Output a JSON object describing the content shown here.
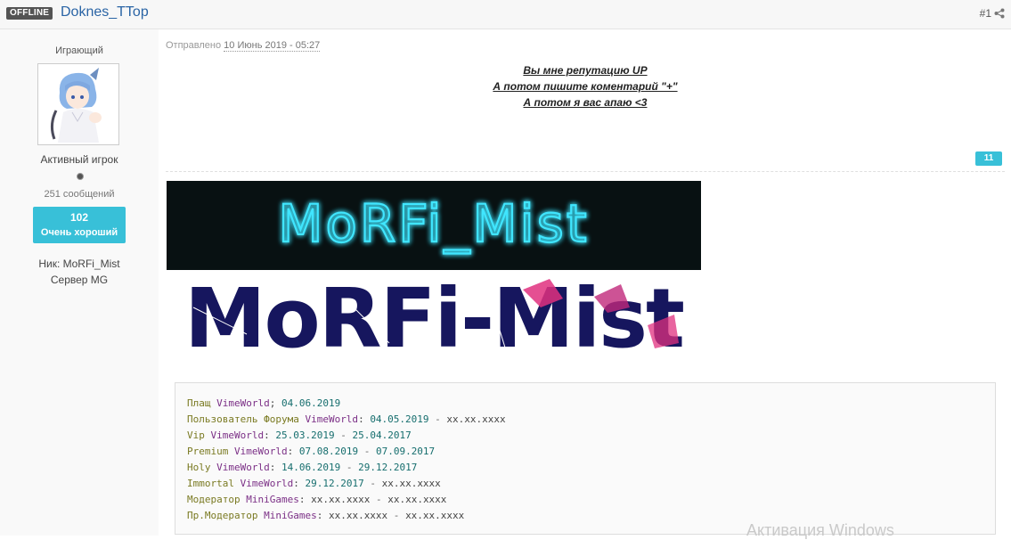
{
  "header": {
    "status_badge": "OFFLINE",
    "author_name": "Doknes_TTop",
    "post_number": "#1",
    "share_icon": "share-icon"
  },
  "sidebar": {
    "group_title": "Играющий",
    "rank_title": "Активный игрок",
    "post_count": "251 сообщений",
    "reputation_value": "102",
    "reputation_label": "Очень хороший",
    "custom_fields": [
      "Ник: MoRFi_Mist",
      "Сервер MG"
    ]
  },
  "post": {
    "meta_prefix": "Отправлено",
    "date": "10 Июнь 2019 - 05:27",
    "lines": [
      "Вы мне репутацию UP",
      "А потом пишите коментарий \"+\"",
      "А потом я вас апаю <3"
    ],
    "like_count": "11"
  },
  "signature": {
    "banner1_text": "MoRFi_Mist",
    "banner2_text": "MoRFi-Mist",
    "colors": {
      "neon": "#3fe6ff",
      "navy": "#16165e",
      "pink": "#e0307f"
    }
  },
  "code_lines": [
    [
      {
        "t": "Плащ ",
        "c": "name"
      },
      {
        "t": "VimeWorld",
        "c": "kw"
      },
      {
        "t": "; ",
        "c": "plain"
      },
      {
        "t": "04.06.2019",
        "c": "date"
      }
    ],
    [
      {
        "t": "Пользователь Форума ",
        "c": "name"
      },
      {
        "t": "VimeWorld",
        "c": "kw"
      },
      {
        "t": ": ",
        "c": "plain"
      },
      {
        "t": "04.05.2019",
        "c": "date"
      },
      {
        "t": " - ",
        "c": "dash"
      },
      {
        "t": "xx.xx.xxxx",
        "c": "plain"
      }
    ],
    [
      {
        "t": "Vip ",
        "c": "name"
      },
      {
        "t": "VimeWorld",
        "c": "kw"
      },
      {
        "t": ": ",
        "c": "plain"
      },
      {
        "t": "25.03.2019",
        "c": "date"
      },
      {
        "t": " - ",
        "c": "dash"
      },
      {
        "t": "25.04.2017",
        "c": "date"
      }
    ],
    [
      {
        "t": "Premium ",
        "c": "name"
      },
      {
        "t": "VimeWorld",
        "c": "kw"
      },
      {
        "t": ": ",
        "c": "plain"
      },
      {
        "t": "07.08.2019",
        "c": "date"
      },
      {
        "t": " - ",
        "c": "dash"
      },
      {
        "t": "07.09.2017",
        "c": "date"
      }
    ],
    [
      {
        "t": "Holy ",
        "c": "name"
      },
      {
        "t": "VimeWorld",
        "c": "kw"
      },
      {
        "t": ": ",
        "c": "plain"
      },
      {
        "t": "14.06.2019",
        "c": "date"
      },
      {
        "t": " - ",
        "c": "dash"
      },
      {
        "t": "29.12.2017",
        "c": "date"
      }
    ],
    [
      {
        "t": "Immortal ",
        "c": "name"
      },
      {
        "t": "VimeWorld",
        "c": "kw"
      },
      {
        "t": ": ",
        "c": "plain"
      },
      {
        "t": "29.12.2017",
        "c": "date"
      },
      {
        "t": " - ",
        "c": "dash"
      },
      {
        "t": "xx.xx.xxxx",
        "c": "plain"
      }
    ],
    [
      {
        "t": "Модератор ",
        "c": "name"
      },
      {
        "t": "MiniGames",
        "c": "kw"
      },
      {
        "t": ": ",
        "c": "plain"
      },
      {
        "t": "xx.xx.xxxx",
        "c": "plain"
      },
      {
        "t": " - ",
        "c": "dash"
      },
      {
        "t": "xx.xx.xxxx",
        "c": "plain"
      }
    ],
    [
      {
        "t": "Пр.Модератор ",
        "c": "name"
      },
      {
        "t": "MiniGames",
        "c": "kw"
      },
      {
        "t": ": ",
        "c": "plain"
      },
      {
        "t": "xx.xx.xxxx",
        "c": "plain"
      },
      {
        "t": " - ",
        "c": "dash"
      },
      {
        "t": "xx.xx.xxxx",
        "c": "plain"
      }
    ]
  ],
  "overlay": {
    "watermark": "Активация Windows"
  }
}
